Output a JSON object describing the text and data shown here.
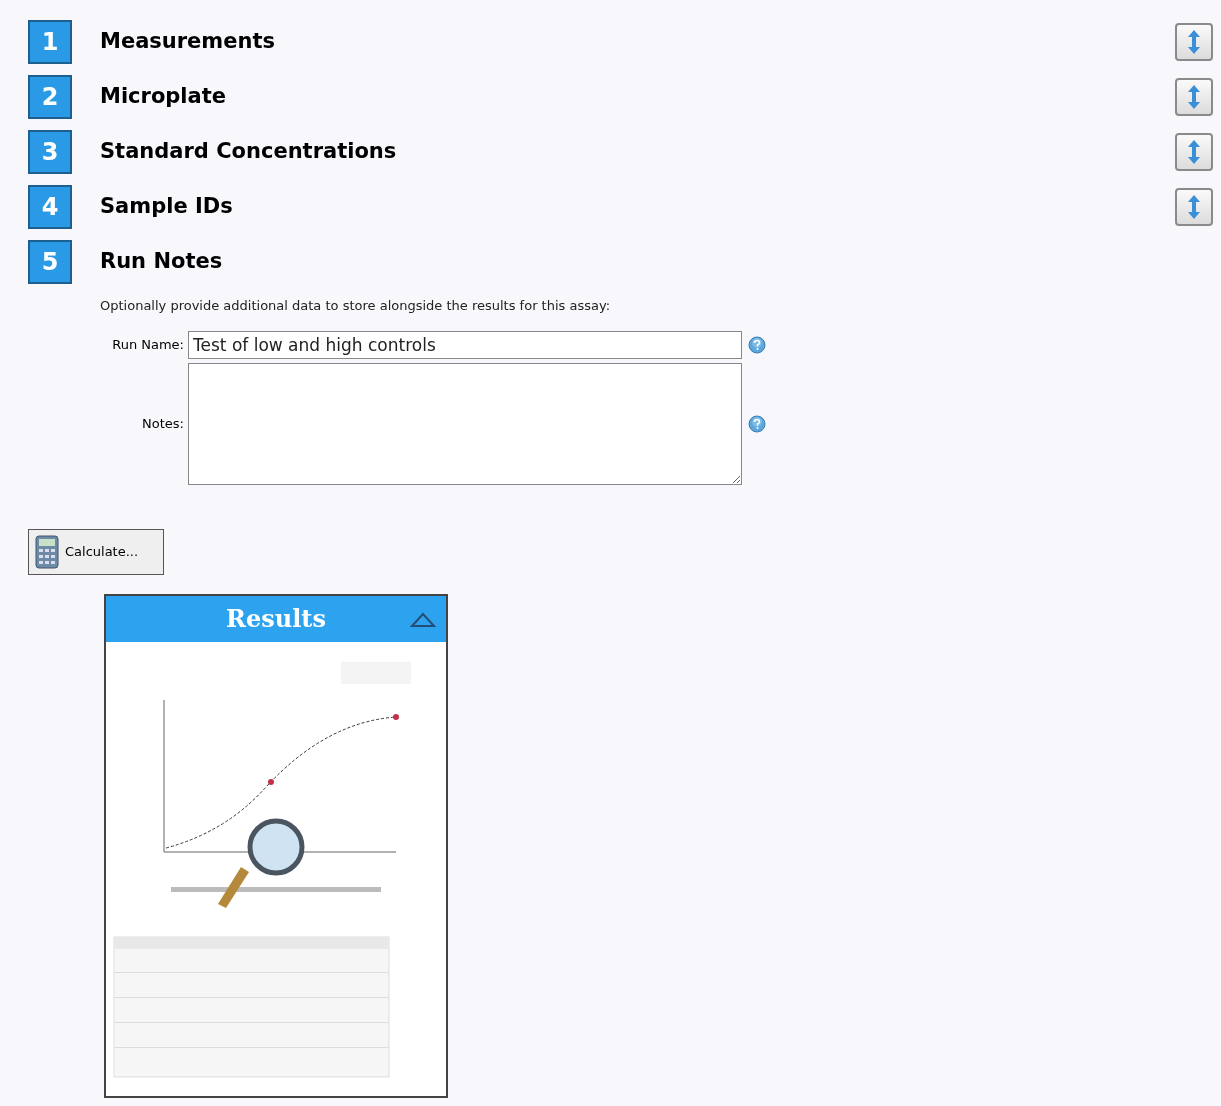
{
  "steps": [
    {
      "number": "1",
      "title": "Measurements",
      "expanded": false
    },
    {
      "number": "2",
      "title": "Microplate",
      "expanded": false
    },
    {
      "number": "3",
      "title": "Standard Concentrations",
      "expanded": false
    },
    {
      "number": "4",
      "title": "Sample IDs",
      "expanded": false
    },
    {
      "number": "5",
      "title": "Run Notes",
      "expanded": true
    }
  ],
  "run_notes": {
    "description": "Optionally provide additional data to store alongside the results for this assay:",
    "run_name": {
      "label": "Run Name:",
      "value": "Test of low and high controls"
    },
    "notes": {
      "label": "Notes:"
    }
  },
  "calculate_button": "Calculate...",
  "results": {
    "title": "Results",
    "expanded": true
  }
}
